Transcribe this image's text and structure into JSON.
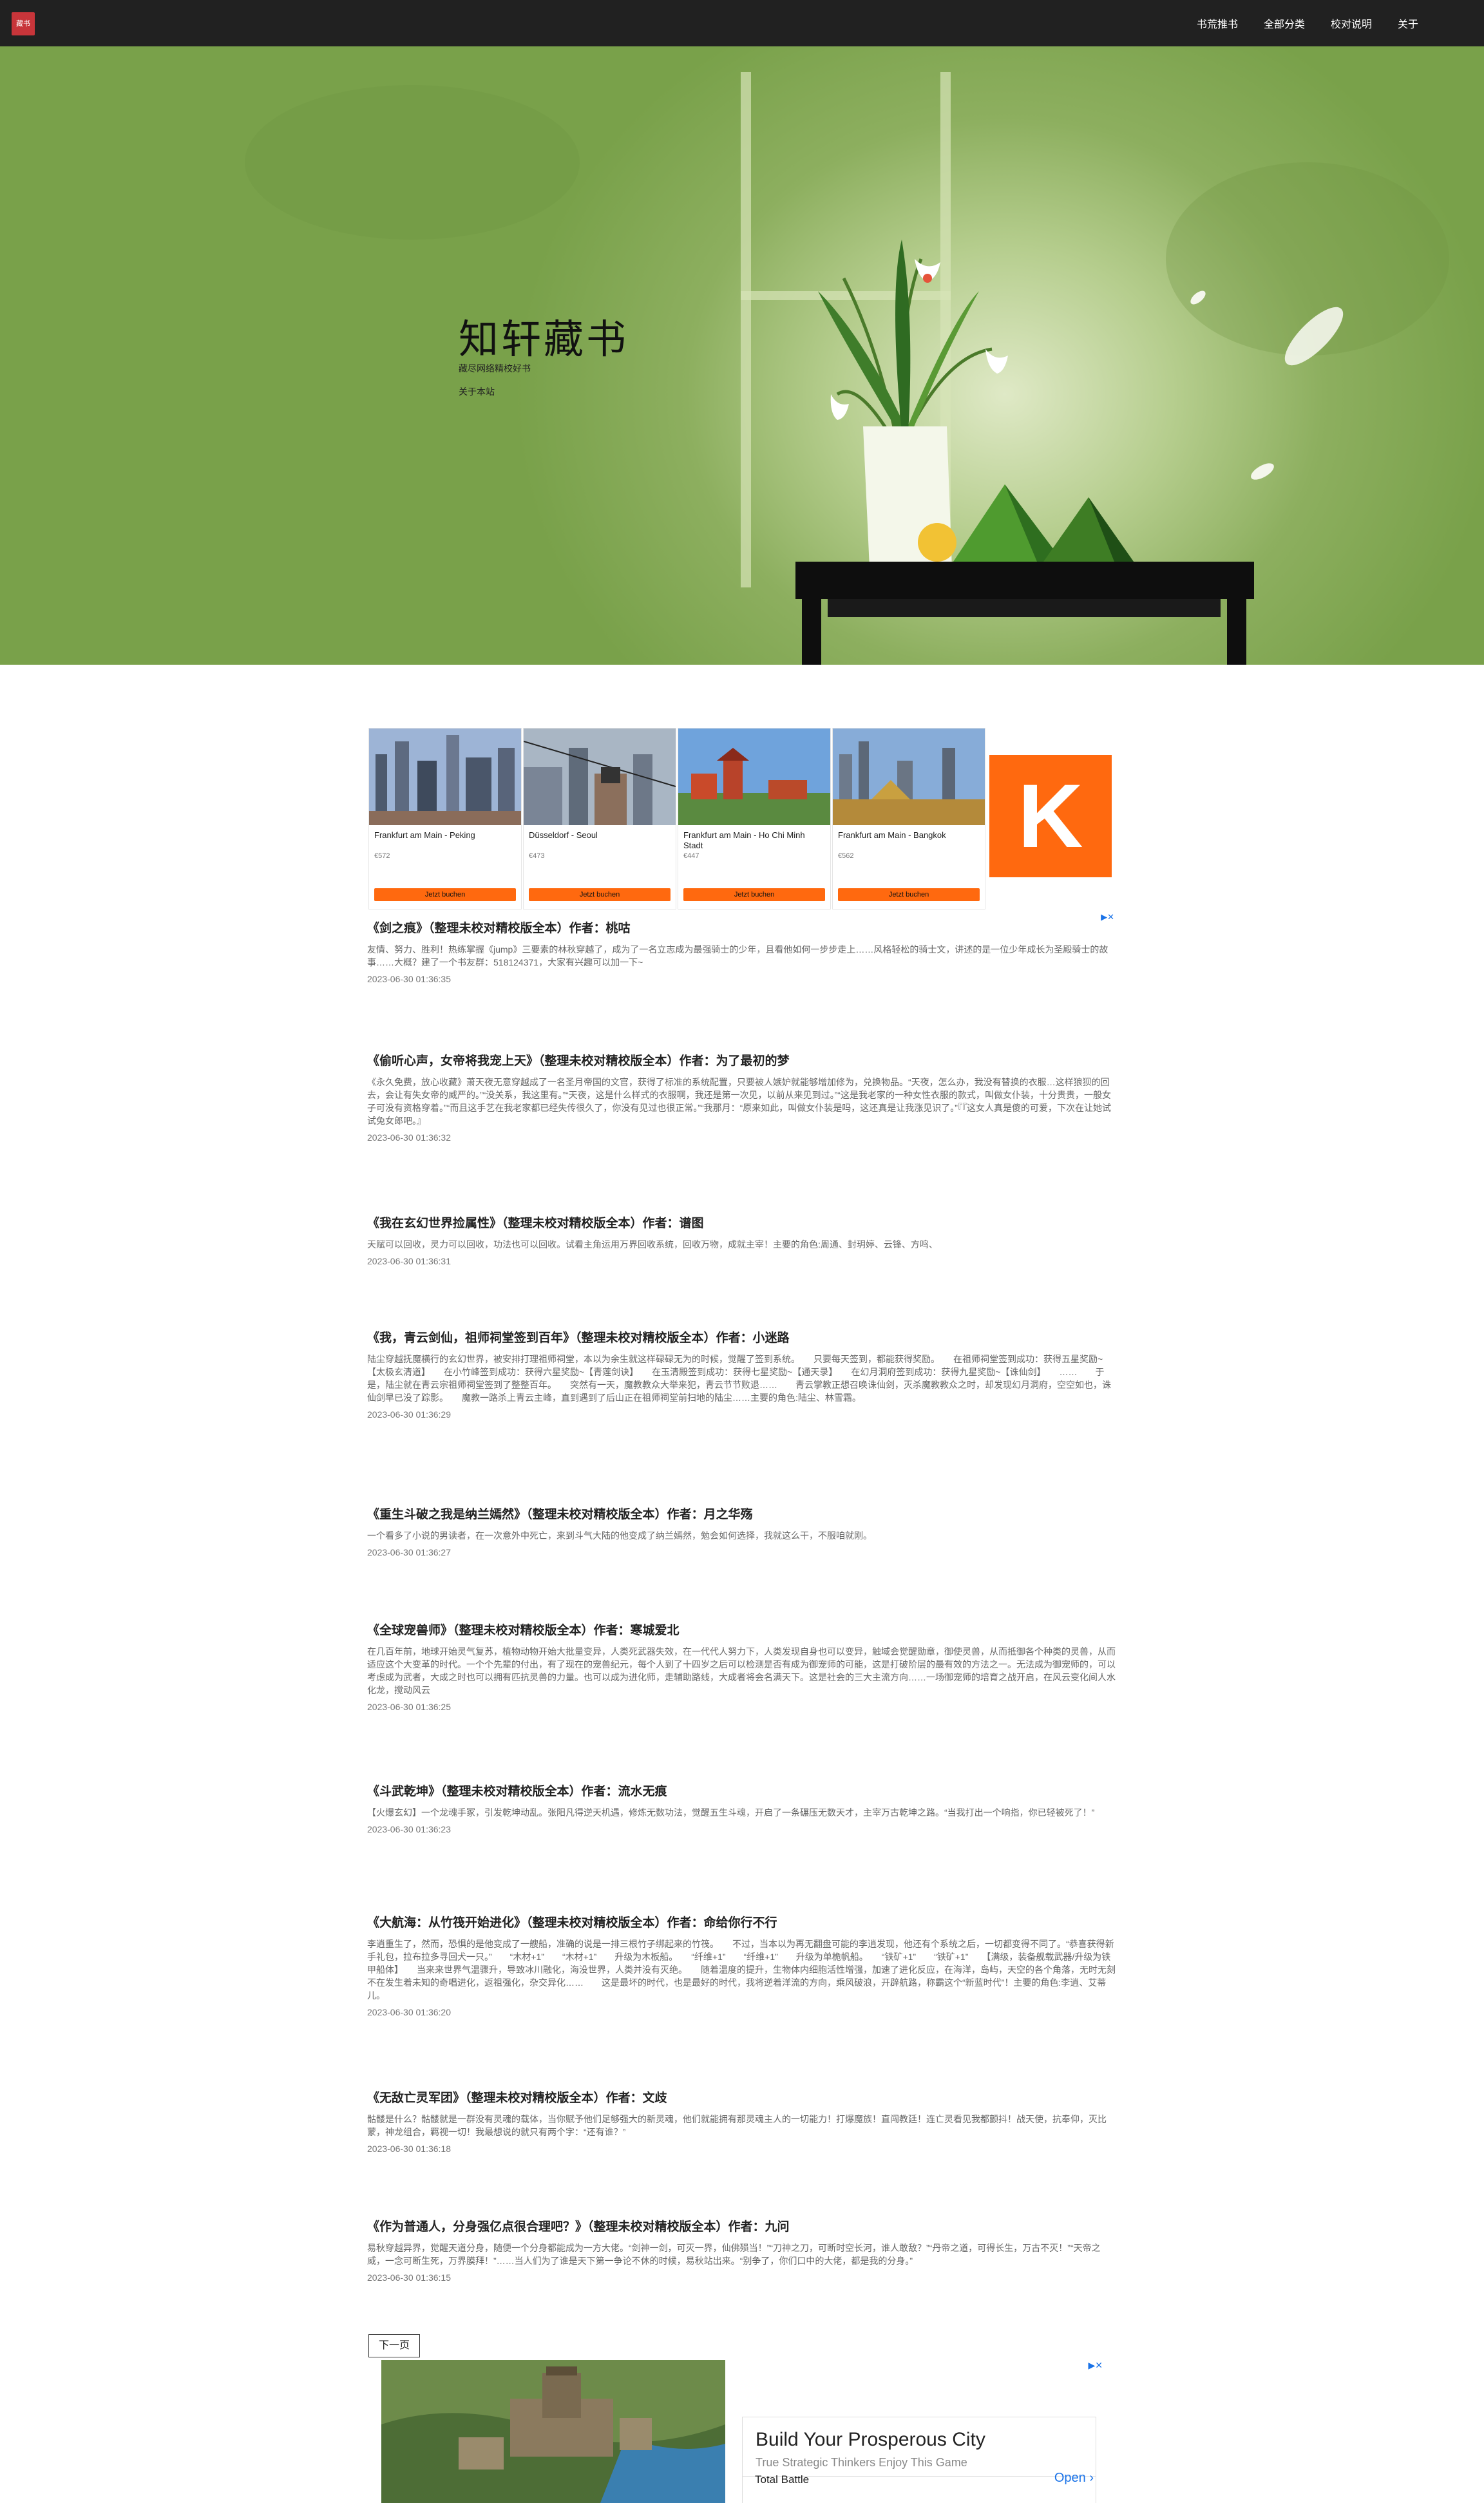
{
  "header": {
    "logo_text": "藏书",
    "nav": [
      "书荒推书",
      "全部分类",
      "校对说明",
      "关于"
    ]
  },
  "hero": {
    "title": "知轩藏书",
    "subtitle": "藏尽网络精校好书",
    "about_link": "关于本站"
  },
  "ad_top": {
    "cards": [
      {
        "route": "Frankfurt am Main - Peking",
        "price": "€572",
        "button": "Jetzt buchen"
      },
      {
        "route": "Düsseldorf - Seoul",
        "price": "€473",
        "button": "Jetzt buchen"
      },
      {
        "route": "Frankfurt am Main - Ho Chi Minh Stadt",
        "price": "€447",
        "button": "Jetzt buchen"
      },
      {
        "route": "Frankfurt am Main - Bangkok",
        "price": "€562",
        "button": "Jetzt buchen"
      }
    ],
    "brand_letter": "K",
    "adchoices": "▶✕"
  },
  "books": [
    {
      "title": "《剑之痕》（整理未校对精校版全本）作者：桃咕",
      "desc": "友情、努力、胜利！热练掌握《jump》三要素的林秋穿越了，成为了一名立志成为最强骑士的少年，且看他如何一步步走上……风格轻松的骑士文，讲述的是一位少年成长为圣殿骑士的故事……大概？建了一个书友群：518124371，大家有兴趣可以加一下~",
      "time": "2023-06-30 01:36:35"
    },
    {
      "title": "《偷听心声，女帝将我宠上天》（整理未校对精校版全本）作者：为了最初的梦",
      "desc": "《永久免费，放心收藏》萧天夜无意穿越成了一名圣月帝国的文官，获得了标准的系统配置，只要被人嫉妒就能够增加修为，兑换物品。“天夜，怎么办，我没有替换的衣服…这样狼狈的回去，会让有失女帝的威严的。”“没关系，我这里有。”“天夜，这是什么样式的衣服啊，我还是第一次见，以前从来见到过。”“这是我老家的一种女性衣服的款式，叫做女仆装，十分贵贵，一般女子可没有资格穿着。”“而且这手艺在我老家都已经失传很久了，你没有见过也很正常。”“我那月：“原来如此，叫做女仆装是吗，这还真是让我涨见识了。”『『这女人真是傻的可爱，下次在让她试试兔女郎吧。』",
      "time": "2023-06-30 01:36:32"
    },
    {
      "title": "《我在玄幻世界捡属性》（整理未校对精校版全本）作者：谱图",
      "desc": "天赋可以回收，灵力可以回收，功法也可以回收。试看主角运用万界回收系统，回收万物，成就主宰！主要的角色:周通、封玥婷、云锋、方鸣、",
      "time": "2023-06-30 01:36:31"
    },
    {
      "title": "《我，青云剑仙，祖师祠堂签到百年》（整理未校对精校版全本）作者：小迷路",
      "desc": "陆尘穿越抚魔横行的玄幻世界，被安排打理祖师祠堂，本以为余生就这样碌碌无为的时候，觉醒了签到系统。　　只要每天签到，都能获得奖励。　　在祖师祠堂签到成功：获得五星奖励~【太极玄清道】　　在小竹峰签到成功：获得六星奖励~【青莲剑诀】　　在玉清殿签到成功：获得七星奖励~【通天录】　　在幻月洞府签到成功：获得九星奖励~【诛仙剑】　　……　　于是，陆尘就在青云宗祖师祠堂签到了整整百年。　　突然有一天，魔教教众大举来犯，青云节节败退……　　青云掌教正想召唤诛仙剑，灭杀魔教教众之时，却发现幻月洞府，空空如也，诛仙剑早已没了踪影。　　魔教一路杀上青云主峰，直到遇到了后山正在祖师祠堂前扫地的陆尘……主要的角色:陆尘、林雪霜。",
      "time": "2023-06-30 01:36:29"
    },
    {
      "title": "《重生斗破之我是纳兰嫣然》（整理未校对精校版全本）作者：月之华殇",
      "desc": "一个看多了小说的男读者，在一次意外中死亡，来到斗气大陆的他变成了纳兰嫣然，勉会如何选择，我就这么干，不服咱就刚。",
      "time": "2023-06-30 01:36:27"
    },
    {
      "title": "《全球宠兽师》（整理未校对精校版全本）作者：寒城爱北",
      "desc": "在几百年前，地球开始灵气复苏，植物动物开始大批量变异，人类死武器失效，在一代代人努力下，人类发现自身也可以变异，触域会觉醒勋章，御使灵兽，从而抵御各个种类的灵兽，从而适应这个大变革的时代。一个个先辈的付出，有了现在的宠兽纪元，每个人到了十四岁之后可以检测是否有成为御宠师的可能，这是打破阶层的最有效的方法之一。无法成为御宠师的，可以考虑成为武者，大成之时也可以拥有匹抗灵兽的力量。也可以成为进化师，走辅助路线，大成者将会名满天下。这是社会的三大主流方向……一场御宠师的培育之战开启，在风云变化间人水化龙，搅动风云",
      "time": "2023-06-30 01:36:25"
    },
    {
      "title": "《斗武乾坤》（整理未校对精校版全本）作者：流水无痕",
      "desc": "【火爆玄幻】一个龙魂手冢，引发乾坤动乱。张阳凡得逆天机遇，修炼无数功法，觉醒五生斗魂，开启了一条碾压无数天才，主宰万古乾坤之路。“当我打出一个响指，你已轻被死了！”",
      "time": "2023-06-30 01:36:23"
    },
    {
      "title": "《大航海：从竹筏开始进化》（整理未校对精校版全本）作者：命给你行不行",
      "desc": "李逍重生了，然而，恐惧的是他变成了一艘船，准确的说是一排三根竹子绑起来的竹筏。　　不过，当本以为再无翻盘可能的李逍发现，他还有个系统之后，一切都变得不同了。“恭喜获得新手礼包，拉布拉多寻回犬一只。”　　“木材+1”　　“木材+1”　　升级为木板船。　　“纤维+1”　　“纤维+1”　　升级为单桅帆船。　　“铁矿+1”　　“铁矿+1”　　【满级，装备舰载武器/升级为铁甲船体】　　当来来世界气温骤升，导致冰川融化，海没世界，人类并没有灭绝。　　随着温度的提升，生物体内细胞活性增强，加速了进化反应，在海洋，岛屿，天空的各个角落，无时无刻不在发生着未知的奇唱进化，返祖强化，杂交异化……　　这是最坏的时代，也是最好的时代，我将逆着洋流的方向，乘风破浪，开辟航路，称霸这个“新蓝时代”！主要的角色:李逍、艾蒂儿。",
      "time": "2023-06-30 01:36:20"
    },
    {
      "title": "《无敌亡灵军团》（整理未校对精校版全本）作者：文歧",
      "desc": "骷髅是什么？骷髅就是一群没有灵魂的载体，当你赋予他们足够强大的新灵魂，他们就能拥有那灵魂主人的一切能力！打爆魔族！直闯教廷！连亡灵看见我都颤抖！战天使，抗奉仰，灭比蒙，神龙组合，羁视一切！我最想说的就只有两个字：“还有谁？”",
      "time": "2023-06-30 01:36:18"
    },
    {
      "title": "《作为普通人，分身强亿点很合理吧？》（整理未校对精校版全本）作者：九问",
      "desc": "易秋穿越异界，觉醒天道分身，随便一个分身都能成为一方大佬。“剑神一剑，可灭一界，仙佛殒当！”“刀神之刀，可断时空长河，谁人敢敌？”“丹帝之道，可得长生，万古不灭！”“天帝之威，一念可断生死，万界膜拜！”……当人们为了谁是天下第一争论不休的时候，易秋站出来。“别争了，你们口中的大佬，都是我的分身。”",
      "time": "2023-06-30 01:36:15"
    }
  ],
  "pagination": {
    "next": "下一页"
  },
  "ad_bottom": {
    "headline": "Build Your Prosperous City",
    "subline": "True Strategic Thinkers Enjoy This Game",
    "brand": "Total Battle",
    "cta": "Open",
    "cta_icon": "chevron-right-icon",
    "adchoices": "▶✕"
  }
}
